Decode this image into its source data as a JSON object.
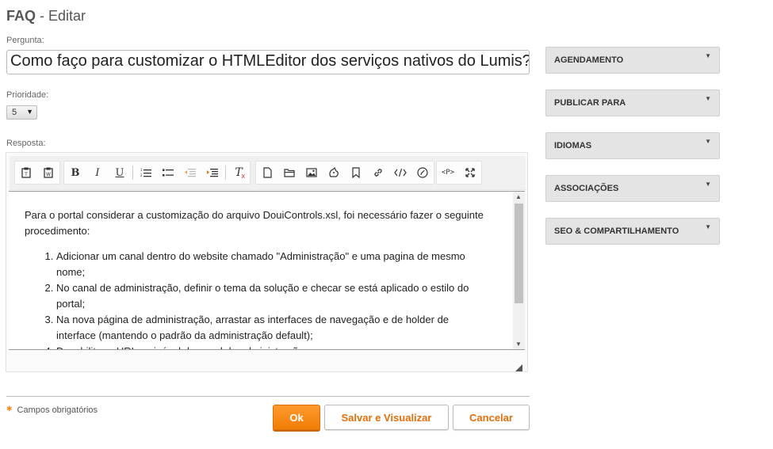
{
  "header": {
    "title_bold": "FAQ",
    "title_rest": " - Editar"
  },
  "question": {
    "label": "Pergunta:",
    "value": "Como faço para customizar o HTMLEditor dos serviços nativos do Lumis?"
  },
  "priority": {
    "label": "Prioridade:",
    "selected": "5"
  },
  "answer": {
    "label": "Resposta:",
    "intro": "Para o portal considerar a customização do arquivo DouiControls.xsl, foi necessário fazer o seguinte procedimento:",
    "steps": [
      "Adicionar um canal dentro do website chamado \"Administração\" e uma pagina de mesmo nome;",
      "No canal de administração, definir o tema da solução e checar se está aplicado o estilo do portal;",
      "Na nova página de administração, arrastar as interfaces de navegação e de holder de interface (mantendo o padrão da administração default);",
      "Desabilitar a URL amigável do canal de administração;"
    ]
  },
  "toolbar": {
    "icons": [
      "paste-text-icon",
      "paste-word-icon",
      "bold-icon",
      "italic-icon",
      "underline-icon",
      "numbered-list-icon",
      "bulleted-list-icon",
      "outdent-icon",
      "indent-icon",
      "remove-format-icon",
      "new-page-icon",
      "open-file-icon",
      "image-icon",
      "flash-icon",
      "anchor-icon",
      "link-icon",
      "source-code-icon",
      "special-char-icon",
      "paragraph-tag-icon",
      "maximize-icon"
    ]
  },
  "footer": {
    "required_note": "Campos obrigatórios",
    "ok_label": "Ok",
    "save_view_label": "Salvar e Visualizar",
    "cancel_label": "Cancelar"
  },
  "panels": [
    {
      "label": "AGENDAMENTO"
    },
    {
      "label": "PUBLICAR PARA"
    },
    {
      "label": "IDIOMAS"
    },
    {
      "label": "ASSOCIAÇÕES"
    },
    {
      "label": "SEO & COMPARTILHAMENTO"
    }
  ],
  "colors": {
    "accent": "#f08a1c",
    "panel_bg": "#e4e4e4"
  }
}
